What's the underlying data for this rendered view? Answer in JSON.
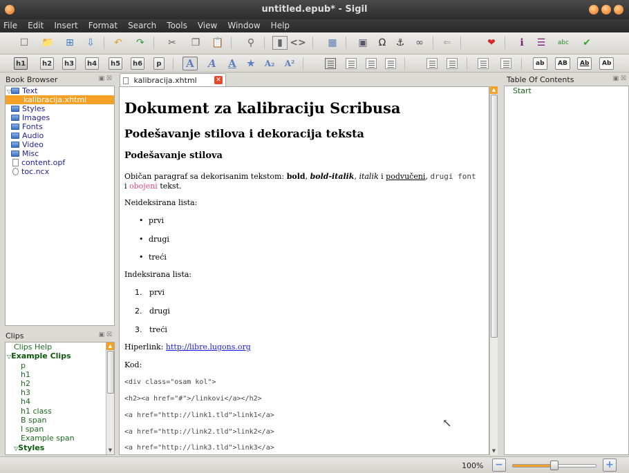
{
  "window": {
    "title": "untitled.epub* - Sigil"
  },
  "menu": [
    "File",
    "Edit",
    "Insert",
    "Format",
    "Search",
    "Tools",
    "View",
    "Window",
    "Help"
  ],
  "toolbar2": {
    "headings": [
      "h1",
      "h2",
      "h3",
      "h4",
      "h5",
      "h6",
      "p"
    ],
    "case_buttons": [
      "ab",
      "AB",
      "Ab",
      "Ab"
    ]
  },
  "book_browser": {
    "title": "Book Browser",
    "items": [
      {
        "label": "Text",
        "type": "folder"
      },
      {
        "label": "kalibracija.xhtml",
        "type": "file",
        "selected": true
      },
      {
        "label": "Styles",
        "type": "folder"
      },
      {
        "label": "Images",
        "type": "folder"
      },
      {
        "label": "Fonts",
        "type": "folder"
      },
      {
        "label": "Audio",
        "type": "folder"
      },
      {
        "label": "Video",
        "type": "folder"
      },
      {
        "label": "Misc",
        "type": "folder"
      },
      {
        "label": "content.opf",
        "type": "file"
      },
      {
        "label": "toc.ncx",
        "type": "file"
      }
    ]
  },
  "clips": {
    "title": "Clips",
    "items": [
      {
        "label": "Clips Help",
        "bold": false
      },
      {
        "label": "Example Clips",
        "bold": true
      },
      {
        "label": "p",
        "bold": false
      },
      {
        "label": "h1",
        "bold": false
      },
      {
        "label": "h2",
        "bold": false
      },
      {
        "label": "h3",
        "bold": false
      },
      {
        "label": "h4",
        "bold": false
      },
      {
        "label": "h1 class",
        "bold": false
      },
      {
        "label": "B span",
        "bold": false
      },
      {
        "label": "I span",
        "bold": false
      },
      {
        "label": "Example span",
        "bold": false
      },
      {
        "label": "Styles",
        "bold": true
      }
    ]
  },
  "tab": {
    "label": "kalibracija.xhtml"
  },
  "document": {
    "h1": "Dokument za kalibraciju Scribusa",
    "h2": "Podešavanje stilova i dekoracija teksta",
    "h3": "Podešavanje stilova",
    "para": {
      "lead": "Običan paragraf sa dekorisanim tekstom: ",
      "bold": "bold",
      "sep1": ", ",
      "bolditalic": "bold-italik",
      "sep2": ", ",
      "italic": "italik",
      "sep3": " i ",
      "underline": "podvučeni",
      "sep4": ", ",
      "mono": "drugi font",
      "sep5": " i ",
      "colored": "obojeni",
      "tail": " tekst."
    },
    "unordered_label": "Neideksirana lista:",
    "unordered": [
      "prvi",
      "drugi",
      "treći"
    ],
    "ordered_label": "Indeksirana lista:",
    "ordered": [
      {
        "n": "1.",
        "text": "prvi"
      },
      {
        "n": "2.",
        "text": "drugi"
      },
      {
        "n": "3.",
        "text": "treći"
      }
    ],
    "link_label": "Hiperlink: ",
    "link_text": "http://libre.lugons.org",
    "code_label": "Kod:",
    "code_lines": [
      "<div class=\"osam kol\">",
      "<h2><a href=\"#\">/linkovi</a></h2>",
      "<a href=\"http://link1.tld\">link1</a>",
      "<a href=\"http://link2.tld\">link2</a>",
      "<a href=\"http://link3.tld\">link3</a>"
    ]
  },
  "toc": {
    "title": "Table Of Contents",
    "items": [
      "Start"
    ]
  },
  "status": {
    "zoom": "100%",
    "zoom_fraction": 0.5
  },
  "colors": {
    "selection": "#f4a125",
    "clip_text": "#1c6b1c",
    "link": "#1a1adb",
    "colored_text": "#e0457a"
  }
}
